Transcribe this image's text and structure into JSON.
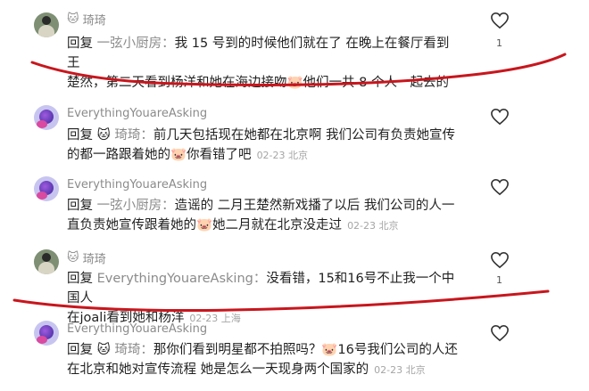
{
  "comments": [
    {
      "user": "琦琦",
      "user_emoji": "🐱",
      "reply_prefix": "回复",
      "reply_to": "一弦小厨房",
      "text_line1": "我 15 号到的时候他们就在了 在晚上在餐厅看到王",
      "text_line2": "楚然，第二天看到杨洋和她在海边接吻🐷他们一共 8 个人一起去的",
      "meta": "",
      "likes": "1"
    },
    {
      "user": "EverythingYouareAsking",
      "reply_prefix": "回复",
      "reply_to_emoji": "🐱",
      "reply_to": "琦琦",
      "text_line1": "前几天包括现在她都在北京啊 我们公司有负责她宣传",
      "text_line2": "的都一路跟着她的🐷你看错了吧",
      "meta": "02-23 北京",
      "likes": ""
    },
    {
      "user": "EverythingYouareAsking",
      "reply_prefix": "回复",
      "reply_to": "一弦小厨房",
      "text_line1": "造谣的 二月王楚然新戏播了以后 我们公司的人一",
      "text_line2": "直负责她宣传跟着她的🐷她二月就在北京没走过",
      "meta": "02-23 北京",
      "likes": ""
    },
    {
      "user": "琦琦",
      "user_emoji": "🐱",
      "reply_prefix": "回复",
      "reply_to": "EverythingYouareAsking",
      "text_line1": "没看错，15和16号不止我一个中国人",
      "text_line2": "在joali看到她和杨洋",
      "meta": "02-23 上海",
      "likes": "1"
    },
    {
      "user": "EverythingYouareAsking",
      "reply_prefix": "回复",
      "reply_to_emoji": "🐱",
      "reply_to": "琦琦",
      "text_line1": "那你们看到明星都不拍照吗？🐷16号我们公司的人还",
      "text_line2": "在北京和她对宣传流程 她是怎么一天现身两个国家的",
      "meta": "02-23 北京",
      "likes": ""
    }
  ],
  "annotation_color": "#c8161d"
}
